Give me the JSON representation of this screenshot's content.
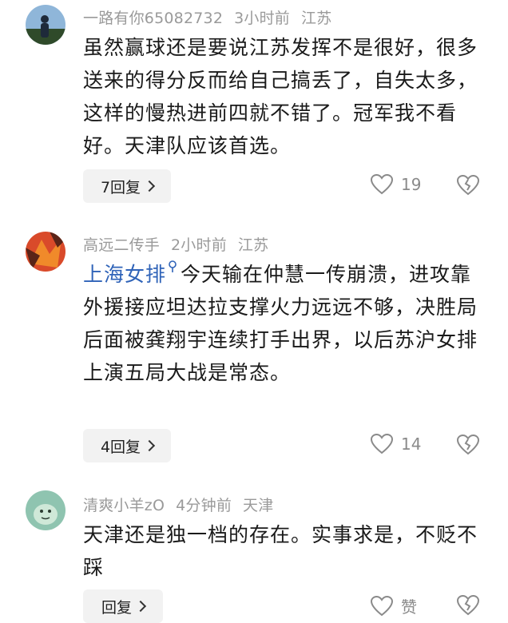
{
  "comments": [
    {
      "username": "一路有你65082732",
      "time": "3小时前",
      "location": "江苏",
      "text": "虽然赢球还是要说江苏发挥不是很好，很多送来的得分反而给自己搞丢了，自失太多，这样的慢热进前四就不错了。冠军我不看好。天津队应该首选。",
      "reply_label": "7回复",
      "likes": "19",
      "avatar_colors": {
        "sky": "#8fb6d9",
        "ground": "#2f4a2a",
        "figure": "#1e2a3a"
      }
    },
    {
      "username": "高远二传手",
      "time": "2小时前",
      "location": "江苏",
      "topic": "上海女排",
      "text": "今天输在仲慧一传崩溃，进攻靠外援接应坦达拉支撑火力远远不够，决胜局后面被龚翔宇连续打手出界，以后苏沪女排上演五局大战是常态。",
      "reply_label": "4回复",
      "likes": "14",
      "avatar_colors": {
        "bg": "#d94a2a",
        "leaf": "#f08a2a",
        "dark": "#5a2418"
      }
    },
    {
      "username": "清爽小羊zO",
      "time": "4分钟前",
      "location": "天津",
      "text": "天津还是独一档的存在。实事求是，不贬不踩",
      "reply_label": "回复",
      "likes": "赞",
      "avatar_colors": {
        "bg": "#8fc4b0",
        "face": "#cfe8d8"
      }
    }
  ],
  "colors": {
    "meta": "#9a9a9a",
    "text": "#1a1a1a",
    "link": "#2f63b8",
    "button_bg": "#f2f2f2",
    "icon": "#8a8a8a"
  },
  "icons": {
    "like": "heart-outline-icon",
    "dislike": "broken-heart-icon",
    "chevron": "chevron-right-icon"
  }
}
